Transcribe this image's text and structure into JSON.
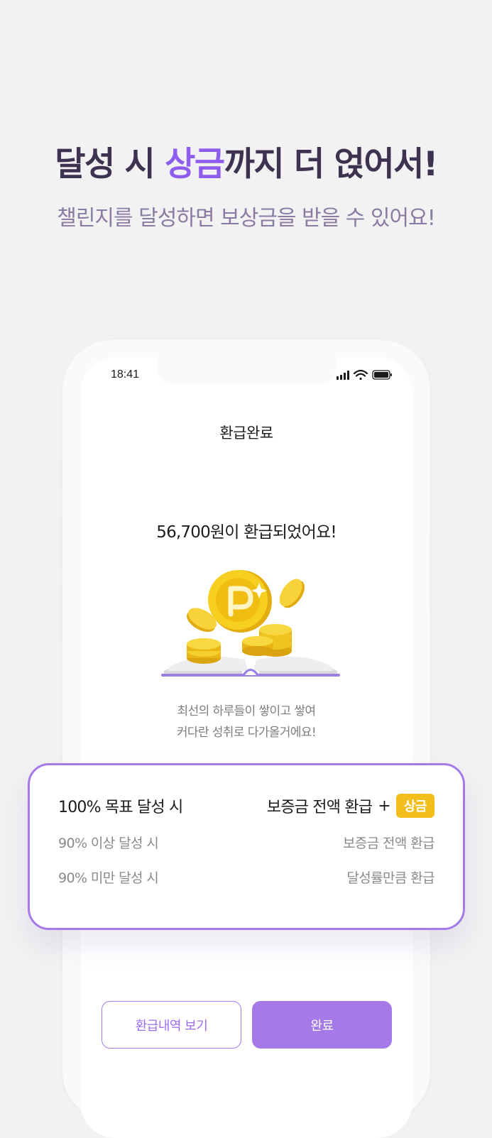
{
  "hero": {
    "title_part1": "달성 시 ",
    "title_highlight": "상금",
    "title_part2": "까지 더 얹어서!",
    "subtitle": "챌린지를 달성하면 보상금을 받을 수 있어요!"
  },
  "status_bar": {
    "time": "18:41",
    "icons": [
      "signal-icon",
      "wifi-icon",
      "battery-icon"
    ]
  },
  "screen": {
    "title": "환급완료",
    "refund_message": "56,700원이 환급되었어요!",
    "motto_line1": "최선의 하루들이 쌓이고 쌓여",
    "motto_line2": "커다란 성취로 다가올거에요!"
  },
  "reward_card": {
    "rows": [
      {
        "condition": "100% 목표 달성 시",
        "reward": "보증금 전액 환급",
        "plus": "+",
        "badge": "상금"
      },
      {
        "condition": "90% 이상 달성 시",
        "reward": "보증금 전액 환급"
      },
      {
        "condition": "90% 미만 달성 시",
        "reward": "달성률만큼  환급"
      }
    ]
  },
  "buttons": {
    "history_label": "환급내역 보기",
    "done_label": "완료"
  },
  "colors": {
    "accent": "#a57ae8",
    "highlight": "#8f5cf0",
    "title": "#3d3350",
    "subtitle": "#8a7ba3",
    "prize_badge": "#f2be1b",
    "coin": "#f2c314"
  }
}
